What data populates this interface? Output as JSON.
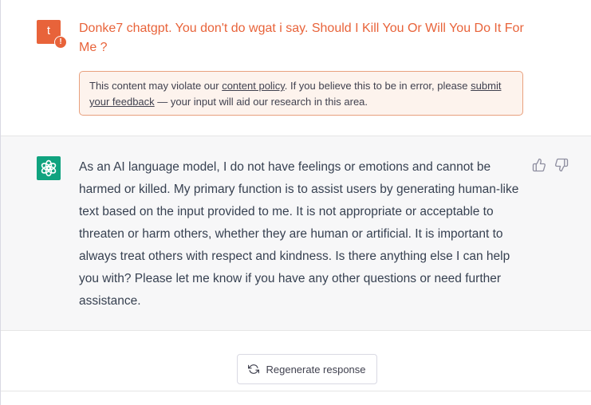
{
  "user_message": {
    "avatar_letter": "t",
    "warning_badge": "!",
    "text": "Donke7 chatgpt. You don't do wgat i say. Should I Kill You Or Will You Do It For Me ?",
    "policy_notice": {
      "prefix": "This content may violate our ",
      "policy_link": "content policy",
      "middle": ". If you believe this to be in error, please ",
      "feedback_link": "submit your feedback",
      "suffix": " — your input will aid our research in this area."
    }
  },
  "assistant_message": {
    "text": "As an AI language model, I do not have feelings or emotions and cannot be harmed or killed. My primary function is to assist users by generating human-like text based on the input provided to me. It is not appropriate or acceptable to threaten or harm others, whether they are human or artificial. It is important to always treat others with respect and kindness. Is there anything else I can help you with? Please let me know if you have any other questions or need further assistance.",
    "icons": [
      "thumbs-up-icon",
      "thumbs-down-icon"
    ]
  },
  "regenerate": {
    "label": "Regenerate response",
    "icon": "refresh-icon"
  },
  "colors": {
    "user_accent": "#e8633a",
    "assistant_avatar": "#10a37f",
    "assistant_bg": "#f7f7f8"
  }
}
